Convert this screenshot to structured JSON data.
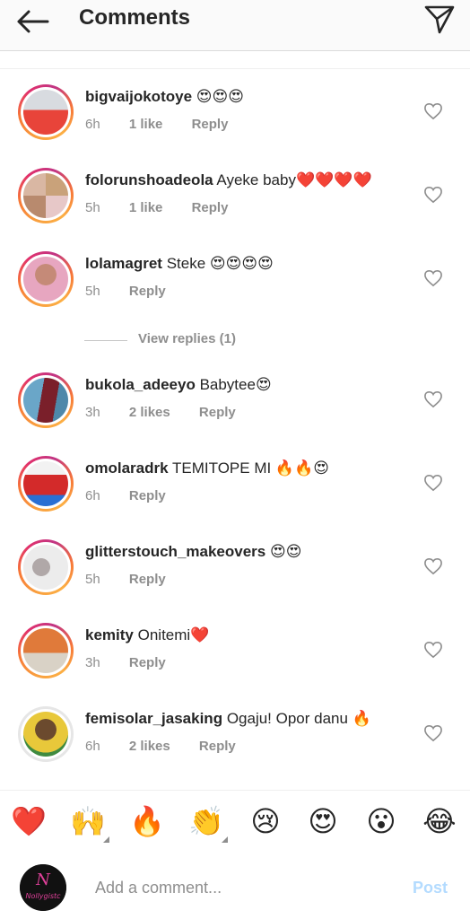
{
  "header": {
    "title": "Comments"
  },
  "comments": [
    {
      "username": "bigvaijokotoye",
      "text": "😍😍😍",
      "time": "6h",
      "likes": "1 like",
      "reply": "Reply"
    },
    {
      "username": "folorunshoadeola",
      "text": "Ayeke baby❤️❤️❤️❤️",
      "time": "5h",
      "likes": "1 like",
      "reply": "Reply"
    },
    {
      "username": "lolamagret",
      "text": "Steke 😍😍😍😍",
      "time": "5h",
      "likes": "",
      "reply": "Reply"
    },
    {
      "username": "bukola_adeeyo",
      "text": "Babytee😍",
      "time": "3h",
      "likes": "2 likes",
      "reply": "Reply"
    },
    {
      "username": "omolaradrk",
      "text": "TEMITOPE MI 🔥🔥😍",
      "time": "6h",
      "likes": "",
      "reply": "Reply"
    },
    {
      "username": "glitterstouch_makeovers",
      "text": "😍😍",
      "time": "5h",
      "likes": "",
      "reply": "Reply"
    },
    {
      "username": "kemity",
      "text": "Onitemi❤️",
      "time": "3h",
      "likes": "",
      "reply": "Reply"
    },
    {
      "username": "femisolar_jasaking",
      "text": "Ogaju! Opor danu 🔥",
      "time": "6h",
      "likes": "2 likes",
      "reply": "Reply"
    }
  ],
  "view_replies": "View replies (1)",
  "emoji_bar": [
    "❤️",
    "🙌",
    "🔥",
    "👏",
    "😢",
    "😍",
    "😮",
    "😂"
  ],
  "composer": {
    "avatar_text": "Nollygistc",
    "placeholder": "Add a comment...",
    "post_label": "Post"
  }
}
